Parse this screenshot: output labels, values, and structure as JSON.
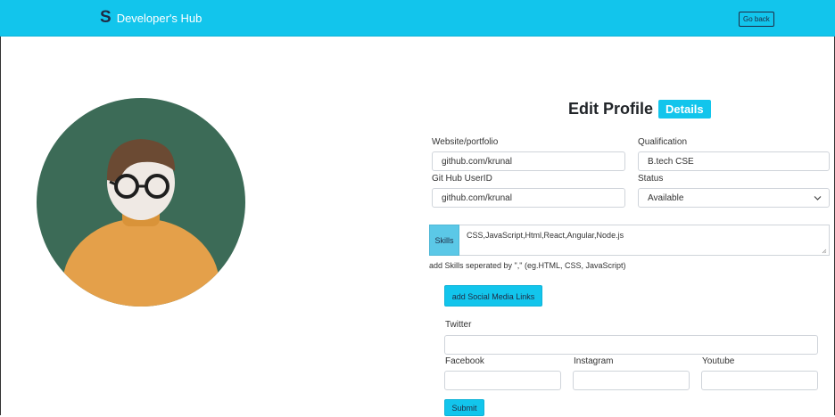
{
  "navbar": {
    "logo": "S",
    "brand": "Developer's Hub",
    "go_back": "Go back"
  },
  "form": {
    "title": "Edit Profile",
    "badge": "Details",
    "website_label": "Website/portfolio",
    "website_value": "github.com/krunal",
    "qualification_label": "Qualification",
    "qualification_value": "B.tech CSE",
    "github_label": "Git Hub UserID",
    "github_value": "github.com/krunal",
    "status_label": "Status",
    "status_value": "Available",
    "skills_label": "Skills",
    "skills_value": "CSS,JavaScript,Html,React,Angular,Node.js",
    "skills_help": "add Skills seperated by \",\" (eg.HTML, CSS, JavaScript)",
    "social_button": "add Social Media Links",
    "twitter_label": "Twitter",
    "facebook_label": "Facebook",
    "instagram_label": "Instagram",
    "youtube_label": "Youtube",
    "submit": "Submit"
  },
  "icons": {
    "chevron": "chevron-down-icon",
    "avatar": "avatar-illustration"
  },
  "colors": {
    "accent": "#12c5ec",
    "skills_tag": "#5bc8e7",
    "avatar_bg": "#3c6b57",
    "shirt": "#e4a04a"
  }
}
